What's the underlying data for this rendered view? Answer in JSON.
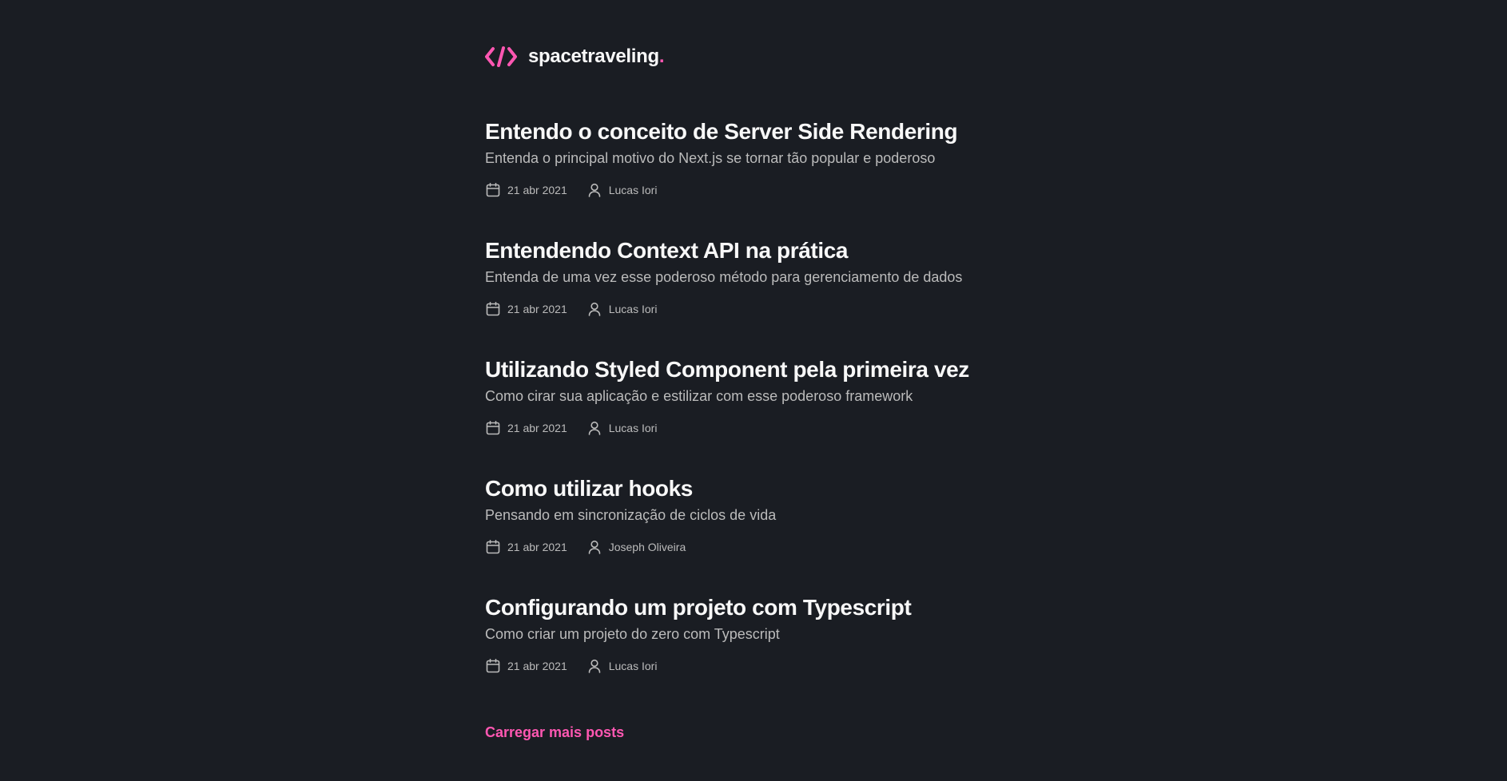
{
  "brand": {
    "name": "spacetraveling",
    "dot": ".",
    "accent_color": "#ff57b2",
    "logo_icon": "code-brackets-icon"
  },
  "posts": [
    {
      "title": "Entendo o conceito de Server Side Rendering",
      "subtitle": "Entenda o principal motivo do Next.js se tornar tão popular e poderoso",
      "date": "21 abr 2021",
      "author": "Lucas Iori"
    },
    {
      "title": "Entendendo Context API na prática",
      "subtitle": "Entenda de uma vez esse poderoso método para gerenciamento de dados",
      "date": "21 abr 2021",
      "author": "Lucas Iori"
    },
    {
      "title": "Utilizando Styled Component pela primeira vez",
      "subtitle": "Como cirar sua aplicação e estilizar com esse poderoso framework",
      "date": "21 abr 2021",
      "author": "Lucas Iori"
    },
    {
      "title": "Como utilizar hooks",
      "subtitle": "Pensando em sincronização de ciclos de vida",
      "date": "21 abr 2021",
      "author": "Joseph Oliveira"
    },
    {
      "title": "Configurando um projeto com Typescript",
      "subtitle": "Como criar um projeto do zero com Typescript",
      "date": "21 abr 2021",
      "author": "Lucas Iori"
    }
  ],
  "load_more_label": "Carregar mais posts"
}
